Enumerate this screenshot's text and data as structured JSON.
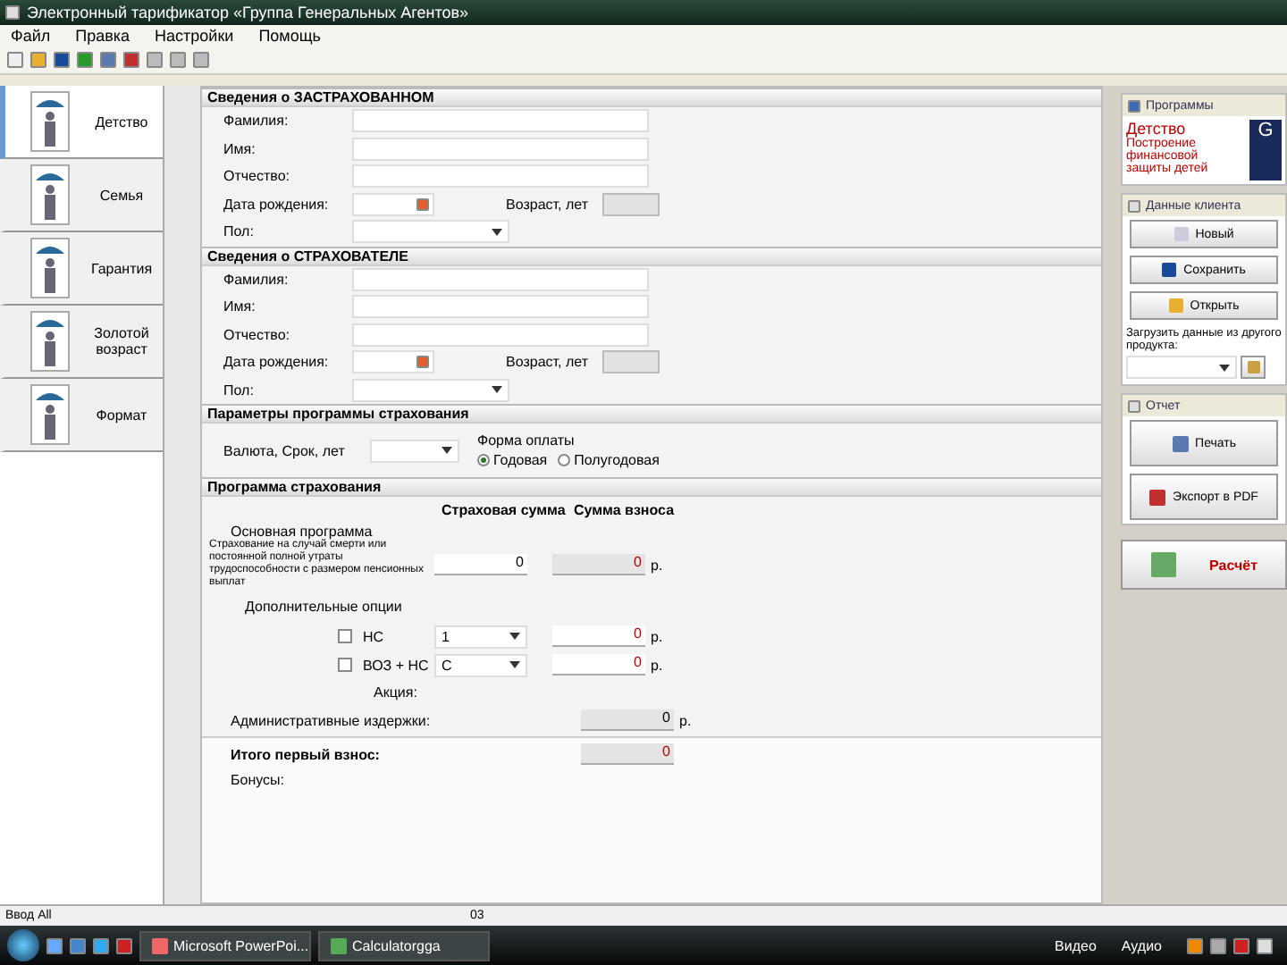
{
  "window": {
    "title": "Электронный тарификатор «Группа Генеральных Агентов»"
  },
  "menu": [
    "Файл",
    "Правка",
    "Настройки",
    "Помощь"
  ],
  "product_tabs": [
    {
      "label": "Детство",
      "selected": true
    },
    {
      "label": "Семья",
      "selected": false
    },
    {
      "label": "Гарантия",
      "selected": false
    },
    {
      "label": "Золотой возраст",
      "selected": false
    },
    {
      "label": "Формат",
      "selected": false
    }
  ],
  "insured": {
    "title": "Сведения о ЗАСТРАХОВАННОМ",
    "fields": [
      {
        "label": "Фамилия:",
        "kind": "text"
      },
      {
        "label": "Имя:",
        "kind": "text"
      },
      {
        "label": "Отчество:",
        "kind": "text"
      },
      {
        "label": "Дата рождения:",
        "kind": "date",
        "age_label": "Возраст, лет"
      },
      {
        "label": "Пол:",
        "kind": "select"
      }
    ]
  },
  "policyholder": {
    "title": "Сведения о СТРАХОВАТЕЛЕ",
    "fields": [
      {
        "label": "Фамилия:",
        "kind": "text"
      },
      {
        "label": "Имя:",
        "kind": "text"
      },
      {
        "label": "Отчество:",
        "kind": "text"
      },
      {
        "label": "Дата рождения:",
        "kind": "date",
        "age_label": "Возраст, лет"
      },
      {
        "label": "Пол:",
        "kind": "select"
      }
    ]
  },
  "parameters": {
    "title": "Параметры программы страхования",
    "currency_label": "Валюта, Срок, лет",
    "payment_label": "Форма оплаты",
    "payment_options": [
      {
        "label": "Годовая",
        "selected": true
      },
      {
        "label": "Полугодовая",
        "selected": false
      }
    ]
  },
  "program": {
    "title": "Программа страхования",
    "columns": [
      "Страховая сумма",
      "Сумма взноса"
    ],
    "main_label": "Основная программа",
    "main_row": {
      "label": "Страхование на случай смерти или постоянной полной утраты трудоспособности с размером пенсионных выплат",
      "sum": "0",
      "premium": "0",
      "unit": "р."
    },
    "options_label": "Дополнительные опции",
    "options": [
      {
        "label": "НС",
        "checked": false,
        "choice": "1",
        "premium": "0",
        "unit": "р."
      },
      {
        "label": "ВОЗ + НС",
        "checked": false,
        "choice": "С",
        "premium": "0",
        "unit": "р."
      }
    ],
    "promo_label": "Акция:",
    "admin": {
      "label": "Административные издержки:",
      "premium": "0",
      "unit": "р."
    },
    "total": {
      "label": "Итого первый взнос:",
      "premium": "0"
    },
    "bonus_label": "Бонусы:"
  },
  "right_panel": {
    "programs_title": "Программы",
    "program_name": "Детство",
    "program_desc": "Построение финансовой защиты детей",
    "logo": "G",
    "client_title": "Данные клиента",
    "client_buttons": [
      "Новый",
      "Сохранить",
      "Открыть"
    ],
    "load_label": "Загрузить данные из другого продукта:",
    "report_title": "Отчет",
    "report_buttons": [
      "Печать",
      "Экспорт в PDF"
    ],
    "calc_button": "Расчёт"
  },
  "status_bar": [
    "Ввод All",
    "03"
  ],
  "taskbar": {
    "windows": [
      "Microsoft PowerPoi...",
      "Calculatorgga"
    ],
    "tray": [
      "Видео",
      "Аудио"
    ]
  }
}
